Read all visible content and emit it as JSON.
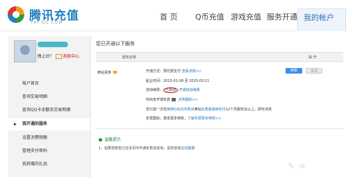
{
  "header": {
    "logo_title": "腾讯充值",
    "logo_sub": "PAY.QQ.COM",
    "nav": [
      "首 页",
      "Q币充值",
      "游戏充值",
      "服务开通",
      "我的帐户"
    ],
    "active_nav": "我的帐户"
  },
  "sidebar": {
    "greeting": "晚上好！",
    "message_link": "消息中心",
    "items": [
      {
        "label": "帐户首页",
        "active": false
      },
      {
        "label": "查询交易明细",
        "active": false
      },
      {
        "label": "查询QQ卡余额及交易明细",
        "active": false
      },
      {
        "label": "我开通的服务",
        "active": true
      },
      {
        "label": "设置消费限额",
        "active": false
      },
      {
        "label": "管理支付密码",
        "active": false
      },
      {
        "label": "我获赠的礼品",
        "active": false
      }
    ]
  },
  "main": {
    "section_title": "您已开通以下服务",
    "col_service": "服务名称",
    "col_action": "操 作",
    "service_name": "黄钻贵族",
    "pay_mode_prefix": "开通方式：预付费支付",
    "pay_mode_link": "查看详情>>",
    "period": "起止时间：2015-01-08 至 2015-03-11",
    "auto_renew_prefix": "自动续费：",
    "auto_renew_status": "已关闭",
    "auto_renew_link": "开通自动续费",
    "notify_prefix": "你尚未开通年费",
    "notify_link": "点亮图标>>",
    "note_line1_prefix": "您只需一次性",
    "note_line1_link": "使用Q点/Q币购买",
    "note_line1_middle": "黄钻",
    "note_line1_link2": "年费或连续包月",
    "note_line1_suffix": "12个月服务及以上，即可点亮",
    "note_line2_prefix": "年费图标，尊享更多特权，",
    "note_line2_link": "了解年费更多特权>>",
    "btn_open": "续费",
    "btn_close": "关闭",
    "tips_title": "温馨提示",
    "tip1_text": "1、如果您想自己在本页中开通年费请咨询，请您咨询",
    "tip1_link": "在线客服"
  }
}
